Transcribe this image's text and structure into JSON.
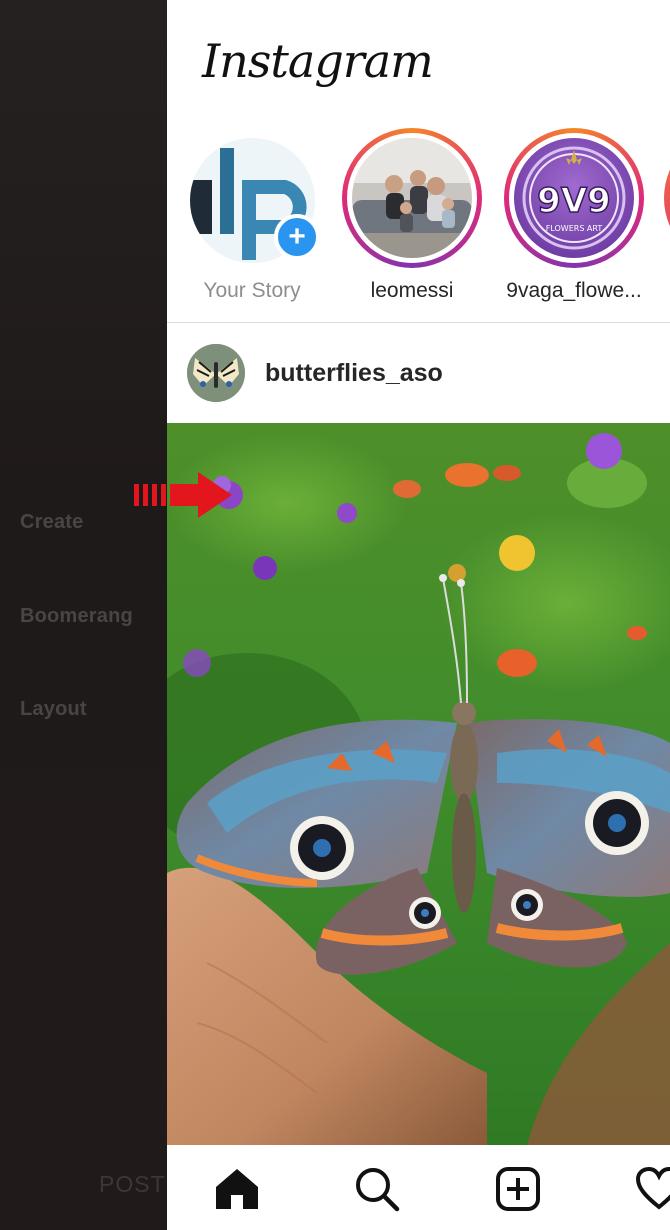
{
  "camera": {
    "modes": [
      "Create",
      "Boomerang",
      "Layout"
    ],
    "bottom_label": "POST"
  },
  "app": {
    "logo": "Instagram",
    "stories": [
      {
        "label": "Your Story",
        "own": true,
        "badge": "+"
      },
      {
        "label": "leomessi"
      },
      {
        "label": "9vaga_flowe...",
        "avatar_text": "9V9",
        "avatar_subtext": "FLOWERS ART"
      }
    ],
    "post": {
      "username": "butterflies_aso"
    },
    "nav": {
      "items": [
        "home-icon",
        "search-icon",
        "new-post-icon",
        "heart-icon"
      ]
    }
  },
  "colors": {
    "accent_blue": "#2a95f0",
    "story_ring": "#dd2a7b",
    "indicator_red": "#e2161c"
  }
}
